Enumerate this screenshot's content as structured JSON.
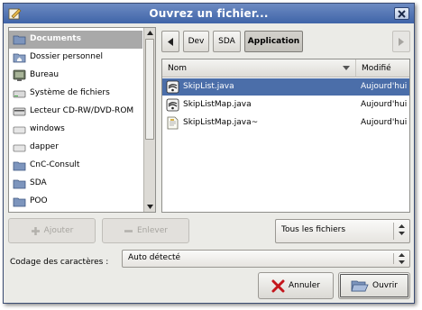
{
  "window": {
    "title": "Ouvrez un fichier..."
  },
  "places": [
    {
      "label": "Documents",
      "icon": "folder-icon",
      "selected": true
    },
    {
      "label": "Dossier personnel",
      "icon": "home-folder-icon"
    },
    {
      "label": "Bureau",
      "icon": "desktop-icon"
    },
    {
      "label": "Système de fichiers",
      "icon": "harddisk-icon"
    },
    {
      "label": "Lecteur CD-RW/DVD-ROM",
      "icon": "cdrom-drive-icon"
    },
    {
      "label": "windows",
      "icon": "drive-icon"
    },
    {
      "label": "dapper",
      "icon": "drive-icon"
    },
    {
      "label": "CnC-Consult",
      "icon": "folder-icon"
    },
    {
      "label": "SDA",
      "icon": "folder-icon"
    },
    {
      "label": "POO",
      "icon": "folder-icon"
    }
  ],
  "path": {
    "buttons": [
      "Dev",
      "SDA",
      "Application"
    ],
    "active": "Application"
  },
  "files": {
    "columns": {
      "name": "Nom",
      "modified": "Modifié"
    },
    "rows": [
      {
        "name": "SkipList.java",
        "modified": "Aujourd'hui",
        "icon": "java-file-icon",
        "selected": true
      },
      {
        "name": "SkipListMap.java",
        "modified": "Aujourd'hui",
        "icon": "java-file-icon"
      },
      {
        "name": "SkipListMap.java~",
        "modified": "Aujourd'hui",
        "icon": "text-file-icon"
      }
    ]
  },
  "actions": {
    "add": "Ajouter",
    "remove": "Enlever"
  },
  "filter": {
    "selected": "Tous les fichiers"
  },
  "encoding": {
    "label": "Codage des caractères :",
    "selected": "Auto détecté"
  },
  "dialog": {
    "cancel": "Annuler",
    "open": "Ouvrir"
  },
  "colors": {
    "title_bar": "#4e70b0",
    "selection": "#4b6ea9",
    "places_selection": "#a9a9a9",
    "background": "#ebebe7"
  }
}
